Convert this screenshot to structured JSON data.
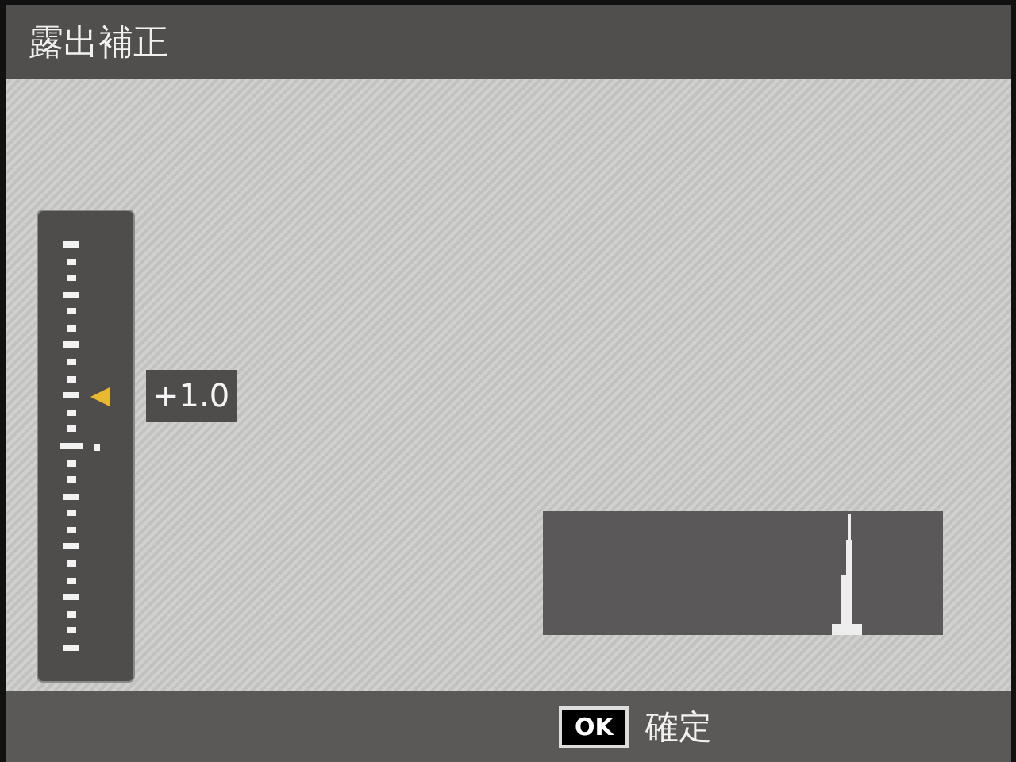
{
  "title": "露出補正",
  "exposure": {
    "value": "+1.0",
    "level": 0.625
  },
  "footer": {
    "key": "OK",
    "action": "確定"
  }
}
